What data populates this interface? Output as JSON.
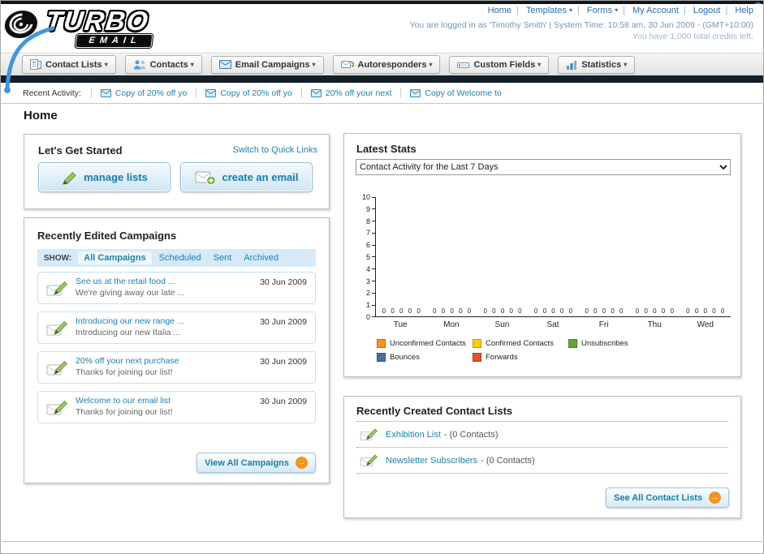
{
  "icons": {
    "caret": "▾",
    "arrow_right": "→"
  },
  "colors": {
    "accent_orange": "#f7941d",
    "link_teal": "#1e7fae",
    "link_blue": "#2a6db5",
    "nav_bar_dark": "#141f29",
    "filter_bar_blue": "#d7eafa"
  },
  "header": {
    "logo_top": "TURBO",
    "logo_bottom": "EMAIL",
    "nav": [
      {
        "label": "Home"
      },
      {
        "label": "Templates"
      },
      {
        "label": "Forms"
      },
      {
        "label": "My Account"
      },
      {
        "label": "Logout"
      },
      {
        "label": "Help"
      }
    ],
    "session_line": "You are logged in as 'Timothy Smith' | System Time: 10:58 am, 30 Jun 2009 - (GMT+10:00)",
    "credits_line": "You have 1,000 total credits left."
  },
  "tabs": [
    {
      "label": "Contact Lists"
    },
    {
      "label": "Contacts"
    },
    {
      "label": "Email Campaigns"
    },
    {
      "label": "Autoresponders"
    },
    {
      "label": "Custom Fields"
    },
    {
      "label": "Statistics"
    }
  ],
  "recent_activity": {
    "label": "Recent Activity:",
    "items": [
      {
        "label": "Copy of 20% off yo"
      },
      {
        "label": "Copy of 20% off yo"
      },
      {
        "label": "20% off your next"
      },
      {
        "label": "Copy of Welcome to"
      }
    ]
  },
  "page": {
    "title": "Home"
  },
  "get_started": {
    "title": "Let's Get Started",
    "switch_link": "Switch to Quick Links",
    "manage_lists_label": "manage lists",
    "create_email_label": "create an email"
  },
  "campaigns": {
    "title": "Recently Edited Campaigns",
    "show_label": "SHOW:",
    "filters": [
      {
        "label": "All Campaigns",
        "active": true
      },
      {
        "label": "Scheduled"
      },
      {
        "label": "Sent"
      },
      {
        "label": "Archived"
      }
    ],
    "items": [
      {
        "title": "See us at the retail food ...",
        "subtitle": "We're giving away our late ...",
        "date": "30 Jun 2009"
      },
      {
        "title": "Introducing our new range ...",
        "subtitle": "Introducing our new Italia ...",
        "date": "30 Jun 2009"
      },
      {
        "title": "20% off your next purchase",
        "subtitle": "Thanks for joining our list!",
        "date": "30 Jun 2009"
      },
      {
        "title": "Welcome to our email list",
        "subtitle": "Thanks for joining our list!",
        "date": "30 Jun 2009"
      }
    ],
    "view_all_label": "View All Campaigns"
  },
  "stats": {
    "title": "Latest Stats",
    "dropdown_value": "Contact Activity for the Last 7 Days",
    "chart_data": {
      "type": "bar",
      "title": "Contact Activity for the Last 7 Days",
      "categories": [
        "Tue",
        "Mon",
        "Sun",
        "Sat",
        "Fri",
        "Thu",
        "Wed"
      ],
      "series": [
        {
          "name": "Unconfirmed Contacts",
          "color": "#f7941d",
          "values": [
            0,
            0,
            0,
            0,
            0,
            0,
            0
          ]
        },
        {
          "name": "Confirmed Contacts",
          "color": "#ffcc00",
          "values": [
            0,
            0,
            0,
            0,
            0,
            0,
            0
          ]
        },
        {
          "name": "Unsubscribes",
          "color": "#64a434",
          "values": [
            0,
            0,
            0,
            0,
            0,
            0,
            0
          ]
        },
        {
          "name": "Bounces",
          "color": "#4a6ea9",
          "values": [
            0,
            0,
            0,
            0,
            0,
            0,
            0
          ]
        },
        {
          "name": "Forwards",
          "color": "#e0552a",
          "values": [
            0,
            0,
            0,
            0,
            0,
            0,
            0
          ]
        }
      ],
      "xlabel": "",
      "ylabel": "",
      "ylim": [
        0,
        10
      ],
      "y_tick_step": 1,
      "grid": false,
      "legend_position": "bottom"
    }
  },
  "contact_lists": {
    "title": "Recently Created Contact Lists",
    "items": [
      {
        "name": "Exhibition List",
        "suffix": "- (0 Contacts)"
      },
      {
        "name": "Newsletter Subscribers",
        "suffix": "- (0 Contacts)"
      }
    ],
    "see_all_label": "See All Contact Lists"
  }
}
